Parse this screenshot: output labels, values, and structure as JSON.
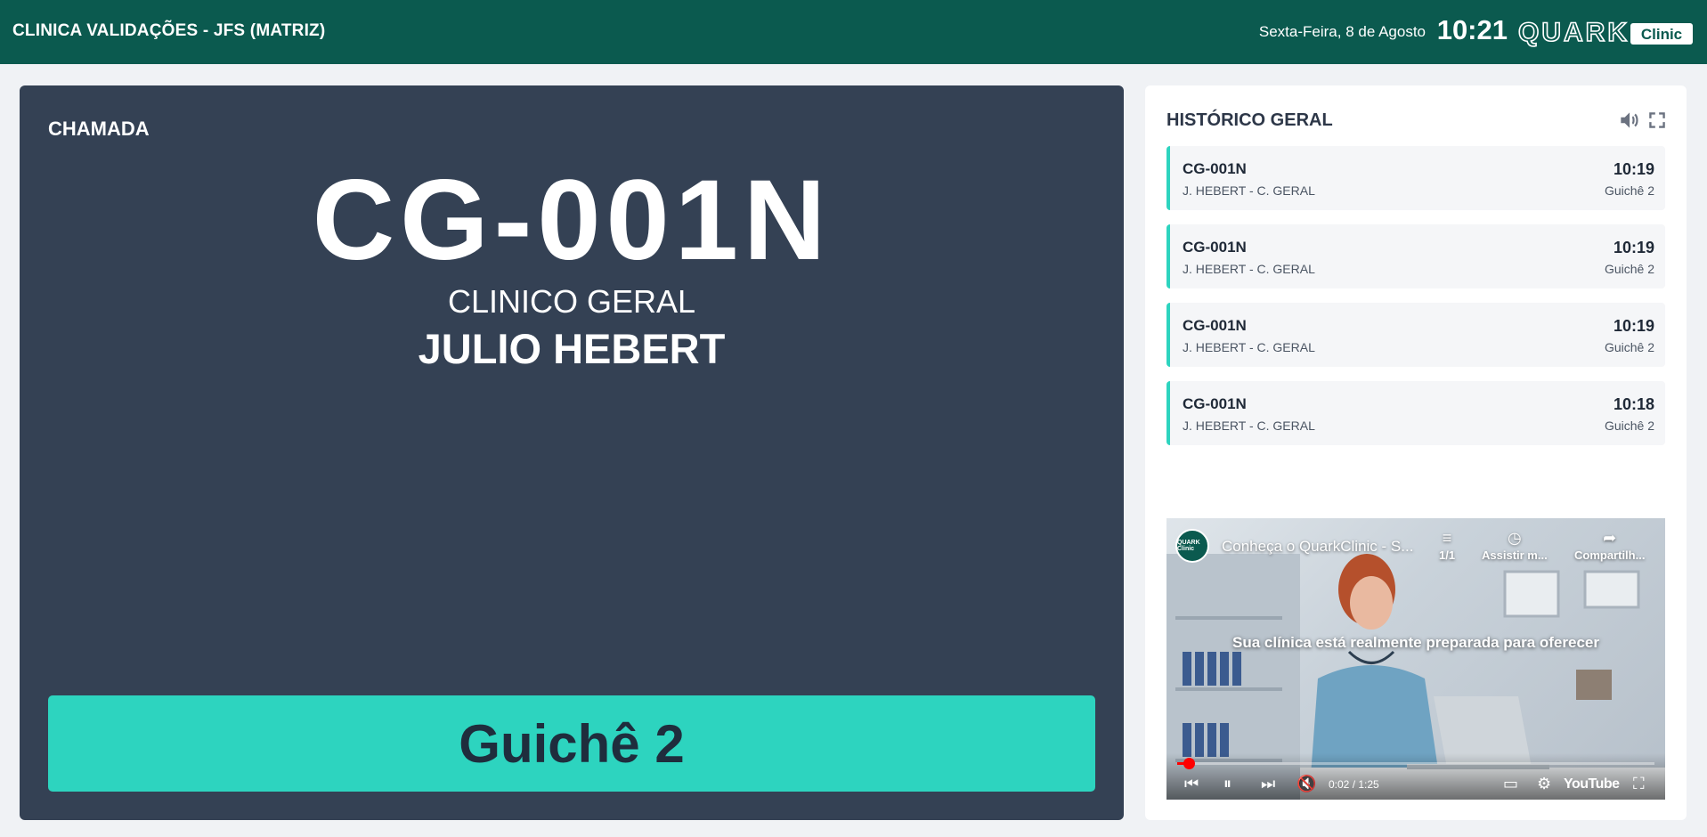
{
  "header": {
    "clinic_name": "CLINICA VALIDAÇÕES - JFS (MATRIZ)",
    "date": "Sexta-Feira, 8 de Agosto",
    "time": "10:21",
    "logo_text": "QUARK",
    "logo_sub": "Clinic",
    "background_color": "#0b5a4f"
  },
  "call": {
    "label": "CHAMADA",
    "ticket": "CG-001N",
    "service": "CLINICO GERAL",
    "professional": "JULIO HEBERT",
    "desk": "Guichê 2",
    "panel_color": "#344154",
    "accent_color": "#2dd4bf"
  },
  "history": {
    "title": "HISTÓRICO GERAL",
    "icons": [
      "volume-icon",
      "fullscreen-icon"
    ],
    "items": [
      {
        "ticket": "CG-001N",
        "description": "J. HEBERT - C. GERAL",
        "time": "10:19",
        "desk": "Guichê 2"
      },
      {
        "ticket": "CG-001N",
        "description": "J. HEBERT - C. GERAL",
        "time": "10:19",
        "desk": "Guichê 2"
      },
      {
        "ticket": "CG-001N",
        "description": "J. HEBERT - C. GERAL",
        "time": "10:19",
        "desk": "Guichê 2"
      },
      {
        "ticket": "CG-001N",
        "description": "J. HEBERT - C. GERAL",
        "time": "10:18",
        "desk": "Guichê 2"
      }
    ]
  },
  "video": {
    "title": "Conheça o QuarkClinic - S...",
    "channel_badge": "QUARK Clinic",
    "playlist_label": "1/1",
    "watch_later_label": "Assistir m...",
    "share_label": "Compartilh...",
    "caption": "Sua clínica está realmente preparada para oferecer",
    "time_display": "0:02 / 1:25",
    "progress": 0.024,
    "youtube_label": "YouTube"
  }
}
